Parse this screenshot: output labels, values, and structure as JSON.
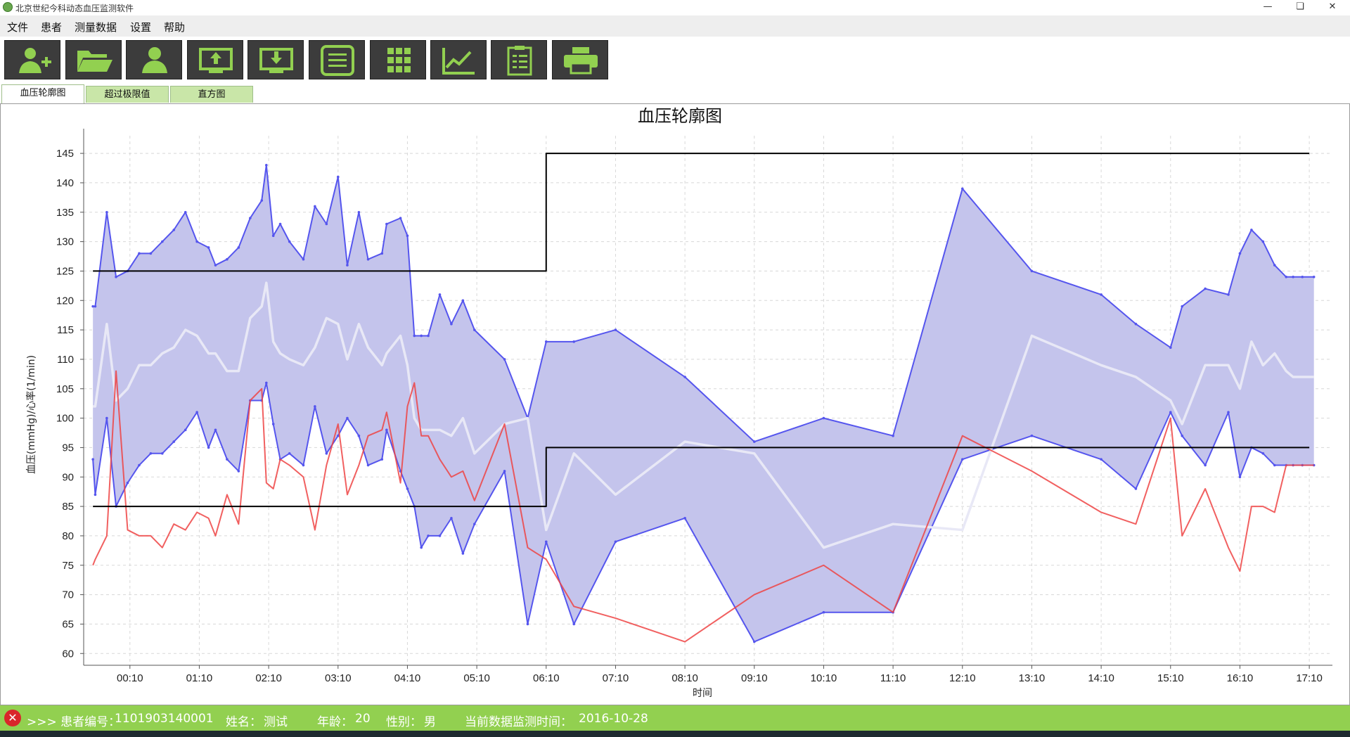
{
  "window": {
    "title": "北京世纪今科动态血压监测软件"
  },
  "menu": [
    "文件",
    "患者",
    "测量数据",
    "设置",
    "帮助"
  ],
  "toolbar": {
    "buttons": [
      {
        "icon": "add-patient-icon"
      },
      {
        "icon": "open-folder-icon"
      },
      {
        "icon": "patient-icon"
      },
      {
        "icon": "upload-monitor-icon"
      },
      {
        "icon": "download-monitor-icon"
      },
      {
        "icon": "list-icon"
      },
      {
        "icon": "grid-icon"
      },
      {
        "icon": "line-chart-icon"
      },
      {
        "icon": "clipboard-icon"
      },
      {
        "icon": "printer-icon"
      }
    ],
    "accent": "#92d050",
    "bg": "#3c3c3c"
  },
  "tabs": [
    "血压轮廓图",
    "超过极限值",
    "直方图"
  ],
  "active_tab": 0,
  "chart_data": {
    "type": "line",
    "title": "血压轮廓图",
    "xlabel": "时间",
    "ylabel": "血压(mmHg)/心率(1/min)",
    "ylim": [
      58,
      148
    ],
    "yticks": [
      60,
      65,
      70,
      75,
      80,
      85,
      90,
      95,
      100,
      105,
      110,
      115,
      120,
      125,
      130,
      135,
      140,
      145
    ],
    "x_unit": "minutes since 00:00 (shown as HH:MM)",
    "xlim": [
      -30,
      1050
    ],
    "xticks": [
      10,
      70,
      130,
      190,
      250,
      310,
      370,
      430,
      490,
      550,
      610,
      670,
      730,
      790,
      850,
      910,
      970,
      1030
    ],
    "xtick_labels": [
      "00:10",
      "01:10",
      "02:10",
      "03:10",
      "04:10",
      "05:10",
      "06:10",
      "07:10",
      "08:10",
      "09:10",
      "10:10",
      "11:10",
      "12:10",
      "13:10",
      "14:10",
      "15:10",
      "16:10",
      "17:10"
    ],
    "grid": true,
    "band_color": "#c4c4ec",
    "series": [
      {
        "color": "#5555ee",
        "x": [
          -22,
          -20,
          -10,
          -2,
          8,
          18,
          28,
          38,
          48,
          58,
          68,
          78,
          84,
          94,
          104,
          114,
          124,
          128,
          134,
          140,
          148,
          160,
          170,
          180,
          190,
          198,
          208,
          216,
          228,
          232,
          244,
          250,
          256,
          262,
          268,
          278,
          288,
          298,
          308,
          334,
          354,
          370,
          394,
          430,
          490,
          550,
          610,
          670,
          730,
          790,
          850,
          880,
          910,
          920,
          940,
          960,
          970,
          980,
          990,
          1000,
          1010,
          1016,
          1024,
          1034
        ],
        "values": [
          119,
          119,
          135,
          124,
          125,
          128,
          128,
          130,
          132,
          135,
          130,
          129,
          126,
          127,
          129,
          134,
          137,
          143,
          131,
          133,
          130,
          127,
          136,
          133,
          141,
          126,
          135,
          127,
          128,
          133,
          134,
          131,
          114,
          114,
          114,
          121,
          116,
          120,
          115,
          110,
          100,
          113,
          113,
          115,
          107,
          96,
          100,
          97,
          139,
          125,
          121,
          116,
          112,
          119,
          122,
          121,
          128,
          132,
          130,
          126,
          124,
          124,
          124,
          124
        ]
      },
      {
        "color": "#5555ee",
        "x": [
          -22,
          -20,
          -10,
          -2,
          8,
          18,
          28,
          38,
          48,
          58,
          68,
          78,
          84,
          94,
          104,
          114,
          124,
          128,
          134,
          140,
          148,
          160,
          170,
          180,
          190,
          198,
          208,
          216,
          228,
          232,
          244,
          250,
          256,
          262,
          268,
          278,
          288,
          298,
          308,
          334,
          354,
          370,
          394,
          430,
          490,
          550,
          610,
          670,
          730,
          790,
          850,
          880,
          910,
          920,
          940,
          960,
          970,
          980,
          990,
          1000,
          1010,
          1016,
          1024,
          1034
        ],
        "values": [
          93,
          87,
          100,
          85,
          89,
          92,
          94,
          94,
          96,
          98,
          101,
          95,
          98,
          93,
          91,
          103,
          103,
          106,
          99,
          93,
          94,
          92,
          102,
          94,
          97,
          100,
          97,
          92,
          93,
          98,
          91,
          88,
          85,
          78,
          80,
          80,
          83,
          77,
          82,
          91,
          65,
          79,
          65,
          79,
          83,
          62,
          67,
          67,
          93,
          97,
          93,
          88,
          101,
          97,
          92,
          101,
          90,
          95,
          94,
          92,
          92,
          92,
          92,
          92
        ]
      },
      {
        "color": "#e8e8f6",
        "x": [
          -22,
          -20,
          -10,
          -2,
          8,
          18,
          28,
          38,
          48,
          58,
          68,
          78,
          84,
          94,
          104,
          114,
          124,
          128,
          134,
          140,
          148,
          160,
          170,
          180,
          190,
          198,
          208,
          216,
          228,
          232,
          244,
          250,
          256,
          262,
          268,
          278,
          288,
          298,
          308,
          334,
          354,
          370,
          394,
          430,
          490,
          550,
          610,
          670,
          730,
          790,
          850,
          880,
          910,
          920,
          940,
          960,
          970,
          980,
          990,
          1000,
          1010,
          1016,
          1024,
          1034
        ],
        "values": [
          102,
          102,
          116,
          103,
          105,
          109,
          109,
          111,
          112,
          115,
          114,
          111,
          111,
          108,
          108,
          117,
          119,
          123,
          113,
          111,
          110,
          109,
          112,
          117,
          116,
          110,
          116,
          112,
          109,
          111,
          114,
          109,
          100,
          98,
          98,
          98,
          97,
          100,
          94,
          99,
          100,
          81,
          94,
          87,
          96,
          94,
          78,
          82,
          81,
          114,
          109,
          107,
          103,
          99,
          109,
          109,
          105,
          113,
          109,
          111,
          108,
          107,
          107,
          107
        ]
      },
      {
        "color": "#ee4444",
        "x": [
          -22,
          -20,
          -10,
          -2,
          8,
          18,
          28,
          38,
          48,
          58,
          68,
          78,
          84,
          94,
          104,
          114,
          124,
          128,
          134,
          140,
          148,
          160,
          170,
          180,
          190,
          198,
          208,
          216,
          228,
          232,
          244,
          250,
          256,
          262,
          268,
          278,
          288,
          298,
          308,
          334,
          354,
          370,
          394,
          430,
          490,
          550,
          610,
          670,
          730,
          790,
          850,
          880,
          910,
          920,
          940,
          960,
          970,
          980,
          990,
          1000,
          1010,
          1016,
          1024,
          1034
        ],
        "values": [
          75,
          76,
          80,
          108,
          81,
          80,
          80,
          78,
          82,
          81,
          84,
          83,
          80,
          87,
          82,
          103,
          105,
          89,
          88,
          93,
          92,
          90,
          81,
          92,
          99,
          87,
          92,
          97,
          98,
          101,
          89,
          102,
          106,
          97,
          97,
          93,
          90,
          91,
          86,
          99,
          78,
          76,
          68,
          66,
          62,
          70,
          75,
          67,
          97,
          91,
          84,
          82,
          100,
          80,
          88,
          78,
          74,
          85,
          85,
          84,
          92,
          92,
          92,
          92
        ]
      },
      {
        "color": "#000000",
        "x": [
          -22,
          370,
          370,
          1030
        ],
        "values": [
          125,
          125,
          145,
          145
        ]
      },
      {
        "color": "#000000",
        "x": [
          -22,
          370,
          370,
          1030
        ],
        "values": [
          85,
          85,
          95,
          95
        ]
      }
    ]
  },
  "status": {
    "prefix": ">>> 患者编号：",
    "patient_id": "1101903140001",
    "name_label": "姓名：",
    "name": "测试",
    "age_label": "年龄：",
    "age": "20",
    "sex_label": "性别：",
    "sex": "男",
    "date_label": "当前数据监测时间：",
    "date": "2016-10-28"
  }
}
